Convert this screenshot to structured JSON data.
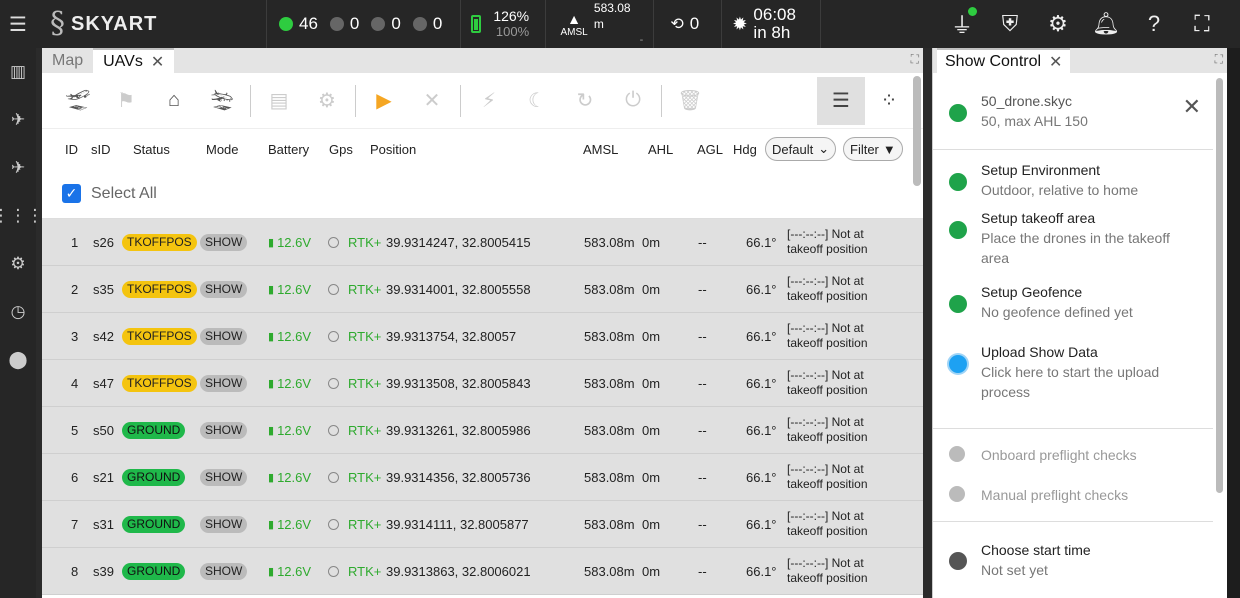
{
  "topbar": {
    "brand": "SKYART",
    "uav_counts": [
      {
        "value": "46",
        "color": "#2ecc40"
      },
      {
        "value": "0",
        "color": "#777777"
      },
      {
        "value": "0",
        "color": "#777777"
      },
      {
        "value": "0",
        "color": "#777777"
      }
    ],
    "battery": {
      "top": "126%",
      "bottom": "100%"
    },
    "altitude": {
      "value": "583.08 m",
      "ref": "AMSL",
      "sub": "-"
    },
    "rtk_count": "0",
    "sun": {
      "time": "06:08",
      "in": "in 8h"
    }
  },
  "sidebar": {
    "items": [
      "map-icon",
      "uav-icon",
      "plane-icon",
      "grid-icon",
      "settings-icon",
      "clock-icon",
      "location-icon"
    ]
  },
  "uav_panel": {
    "tabs": [
      {
        "label": "Map"
      },
      {
        "label": "UAVs"
      }
    ],
    "columns": {
      "id": "ID",
      "sid": "sID",
      "status": "Status",
      "mode": "Mode",
      "battery": "Battery",
      "gps": "Gps",
      "position": "Position",
      "amsl": "AMSL",
      "ahl": "AHL",
      "agl": "AGL",
      "hdg": "Hdg"
    },
    "sort_select": "Default",
    "filter_label": "Filter",
    "select_all": "Select All",
    "rows": [
      {
        "id": "1",
        "sid": "s26",
        "status": "TKOFFPOS",
        "kind": "tk",
        "mode": "SHOW",
        "battery": "12.6V",
        "gps": "RTK+",
        "position": "39.9314247, 32.8005415",
        "amsl": "583.08m",
        "ahl": "0m",
        "agl": "--",
        "hdg": "66.1°",
        "msg1": "[---:--:--] Not at",
        "msg2": "takeoff position"
      },
      {
        "id": "2",
        "sid": "s35",
        "status": "TKOFFPOS",
        "kind": "tk",
        "mode": "SHOW",
        "battery": "12.6V",
        "gps": "RTK+",
        "position": "39.9314001, 32.8005558",
        "amsl": "583.08m",
        "ahl": "0m",
        "agl": "--",
        "hdg": "66.1°",
        "msg1": "[---:--:--] Not at",
        "msg2": "takeoff position"
      },
      {
        "id": "3",
        "sid": "s42",
        "status": "TKOFFPOS",
        "kind": "tk",
        "mode": "SHOW",
        "battery": "12.6V",
        "gps": "RTK+",
        "position": "39.9313754, 32.80057",
        "amsl": "583.08m",
        "ahl": "0m",
        "agl": "--",
        "hdg": "66.1°",
        "msg1": "[---:--:--] Not at",
        "msg2": "takeoff position"
      },
      {
        "id": "4",
        "sid": "s47",
        "status": "TKOFFPOS",
        "kind": "tk",
        "mode": "SHOW",
        "battery": "12.6V",
        "gps": "RTK+",
        "position": "39.9313508, 32.8005843",
        "amsl": "583.08m",
        "ahl": "0m",
        "agl": "--",
        "hdg": "66.1°",
        "msg1": "[---:--:--] Not at",
        "msg2": "takeoff position"
      },
      {
        "id": "5",
        "sid": "s50",
        "status": "GROUND",
        "kind": "gr",
        "mode": "SHOW",
        "battery": "12.6V",
        "gps": "RTK+",
        "position": "39.9313261, 32.8005986",
        "amsl": "583.08m",
        "ahl": "0m",
        "agl": "--",
        "hdg": "66.1°",
        "msg1": "[---:--:--] Not at",
        "msg2": "takeoff position"
      },
      {
        "id": "6",
        "sid": "s21",
        "status": "GROUND",
        "kind": "gr",
        "mode": "SHOW",
        "battery": "12.6V",
        "gps": "RTK+",
        "position": "39.9314356, 32.8005736",
        "amsl": "583.08m",
        "ahl": "0m",
        "agl": "--",
        "hdg": "66.1°",
        "msg1": "[---:--:--] Not at",
        "msg2": "takeoff position"
      },
      {
        "id": "7",
        "sid": "s31",
        "status": "GROUND",
        "kind": "gr",
        "mode": "SHOW",
        "battery": "12.6V",
        "gps": "RTK+",
        "position": "39.9314111, 32.8005877",
        "amsl": "583.08m",
        "ahl": "0m",
        "agl": "--",
        "hdg": "66.1°",
        "msg1": "[---:--:--] Not at",
        "msg2": "takeoff position"
      },
      {
        "id": "8",
        "sid": "s39",
        "status": "GROUND",
        "kind": "gr",
        "mode": "SHOW",
        "battery": "12.6V",
        "gps": "RTK+",
        "position": "39.9313863, 32.8006021",
        "amsl": "583.08m",
        "ahl": "0m",
        "agl": "--",
        "hdg": "66.1°",
        "msg1": "[---:--:--] Not at",
        "msg2": "takeoff position"
      }
    ]
  },
  "show_panel": {
    "tab": "Show Control",
    "file": {
      "name": "50_drone.skyc",
      "desc": "50, max AHL 150"
    },
    "steps": [
      {
        "title": "Setup Environment",
        "sub": "Outdoor, relative to home",
        "color": "#1fa34a"
      },
      {
        "title": "Setup takeoff area",
        "sub": "Place the drones in the takeoff area",
        "color": "#1fa34a"
      },
      {
        "title": "Setup Geofence",
        "sub": "No geofence defined yet",
        "color": "#1fa34a"
      },
      {
        "title": "Upload Show Data",
        "sub": "Click here to start the upload process",
        "color": "#1da1f2"
      }
    ],
    "checks": [
      {
        "title": "Onboard preflight checks",
        "color": "#bbbbbb"
      },
      {
        "title": "Manual preflight checks",
        "color": "#bbbbbb"
      }
    ],
    "start": {
      "title": "Choose start time",
      "sub": "Not set yet",
      "color": "#555555"
    }
  }
}
